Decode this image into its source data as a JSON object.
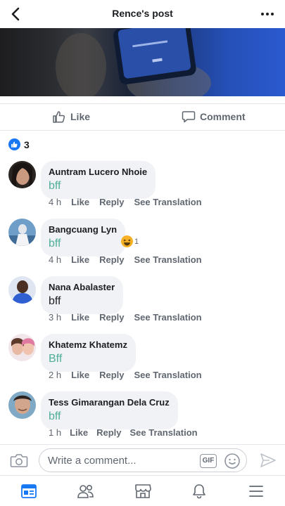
{
  "header": {
    "title": "Rence's post"
  },
  "actions": {
    "like_label": "Like",
    "comment_label": "Comment"
  },
  "reactions": {
    "count": "3"
  },
  "comments": [
    {
      "name": "Auntram Lucero Nhoie",
      "text": "bff",
      "time": "4 h",
      "like": "Like",
      "reply": "Reply",
      "translate": "See Translation",
      "text_color": "#4fae9a"
    },
    {
      "name": "Bangcuang Lyn",
      "text": "bff",
      "time": "4 h",
      "like": "Like",
      "reply": "Reply",
      "translate": "See Translation",
      "text_color": "#4fae9a",
      "reaction_count": "1"
    },
    {
      "name": "Nana Abalaster",
      "text": "bff",
      "time": "3 h",
      "like": "Like",
      "reply": "Reply",
      "translate": "See Translation",
      "text_color": "#1c1e21"
    },
    {
      "name": "Khatemz Khatemz",
      "text": "Bff",
      "time": "2 h",
      "like": "Like",
      "reply": "Reply",
      "translate": "See Translation",
      "text_color": "#4fae9a"
    },
    {
      "name": "Tess Gimarangan Dela Cruz",
      "text": "bff",
      "time": "1 h",
      "like": "Like",
      "reply": "Reply",
      "translate": "See Translation",
      "text_color": "#4fae9a"
    }
  ],
  "composer": {
    "placeholder": "Write a comment...",
    "gif_label": "GIF"
  },
  "colors": {
    "accent": "#1877f2",
    "secondary_text": "#606770",
    "bubble": "#f0f2f5"
  },
  "icons": [
    "back-arrow-icon",
    "more-dots-icon",
    "thumbs-up-icon",
    "comment-icon",
    "camera-icon",
    "emoji-icon",
    "send-icon",
    "news-feed-icon",
    "friends-icon",
    "marketplace-icon",
    "notifications-icon",
    "menu-icon"
  ]
}
